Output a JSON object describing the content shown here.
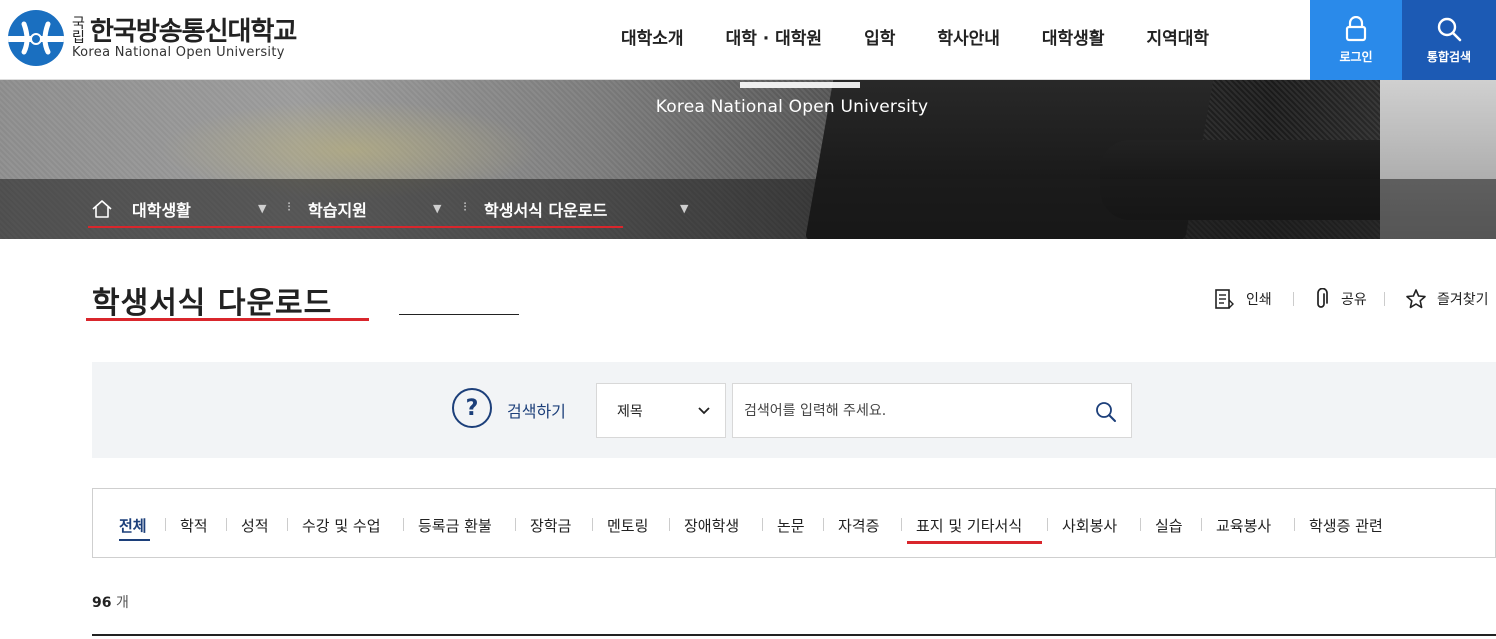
{
  "header": {
    "logo": {
      "small_top": "국",
      "small_bottom": "립",
      "name_ko": "한국방송통신대학교",
      "name_en": "Korea National Open University"
    },
    "nav": [
      "대학소개",
      "대학 · 대학원",
      "입학",
      "학사안내",
      "대학생활",
      "지역대학"
    ],
    "login_label": "로그인",
    "search_label": "통합검색"
  },
  "hero": {
    "subtitle": "Korea National Open University"
  },
  "breadcrumb": {
    "items": [
      "대학생활",
      "학습지원",
      "학생서식 다운로드"
    ]
  },
  "page": {
    "title": "학생서식 다운로드",
    "tools": {
      "print": "인쇄",
      "share": "공유",
      "favorite": "즐겨찾기"
    }
  },
  "search": {
    "label": "검색하기",
    "help_symbol": "?",
    "select_value": "제목",
    "placeholder": "검색어를 입력해 주세요."
  },
  "tabs": {
    "items": [
      "전체",
      "학적",
      "성적",
      "수강 및 수업",
      "등록금 환불",
      "장학금",
      "멘토링",
      "장애학생",
      "논문",
      "자격증",
      "표지 및 기타서식",
      "사회봉사",
      "실습",
      "교육봉사",
      "학생증 관련"
    ],
    "active": "전체"
  },
  "results": {
    "count": "96",
    "unit": "개"
  },
  "colors": {
    "primary": "#1c3f7a",
    "login_bg": "#2a8aea",
    "search_bg": "#1c5ab4",
    "highlight": "#d9262c"
  }
}
